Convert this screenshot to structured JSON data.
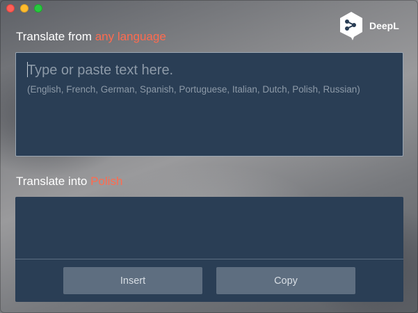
{
  "window": {
    "controls": [
      "close",
      "minimize",
      "zoom"
    ]
  },
  "brand": {
    "name": "DeepL",
    "logo_icon": "deepl-logo-icon"
  },
  "source": {
    "label_prefix": "Translate from ",
    "label_accent": "any language",
    "placeholder": "Type or paste text here.",
    "languages_hint": "(English, French, German, Spanish, Portuguese, Italian, Dutch, Polish, Russian)"
  },
  "target": {
    "label_prefix": "Translate into ",
    "label_accent": "Polish",
    "insert_label": "Insert",
    "copy_label": "Copy"
  },
  "colors": {
    "accent": "#ff6b4f",
    "panel": "#2a3e55",
    "button": "#5e6e80"
  }
}
